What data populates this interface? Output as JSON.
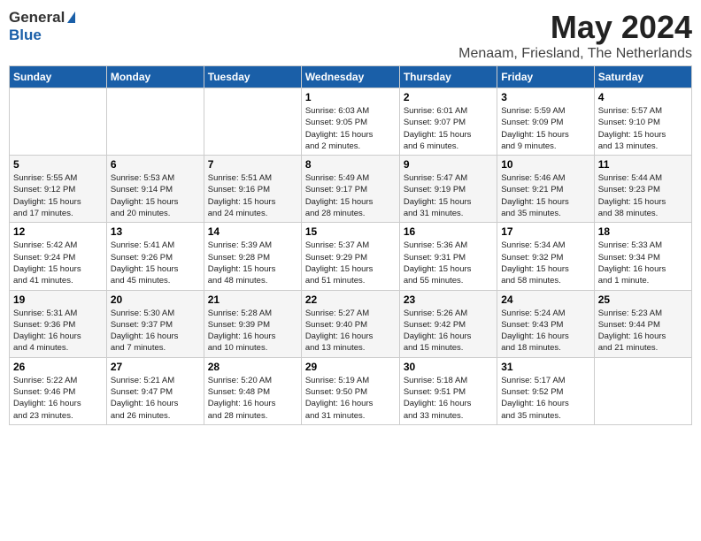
{
  "logo": {
    "general": "General",
    "blue": "Blue"
  },
  "title": "May 2024",
  "location": "Menaam, Friesland, The Netherlands",
  "days_of_week": [
    "Sunday",
    "Monday",
    "Tuesday",
    "Wednesday",
    "Thursday",
    "Friday",
    "Saturday"
  ],
  "weeks": [
    [
      {
        "day": "",
        "info": ""
      },
      {
        "day": "",
        "info": ""
      },
      {
        "day": "",
        "info": ""
      },
      {
        "day": "1",
        "info": "Sunrise: 6:03 AM\nSunset: 9:05 PM\nDaylight: 15 hours\nand 2 minutes."
      },
      {
        "day": "2",
        "info": "Sunrise: 6:01 AM\nSunset: 9:07 PM\nDaylight: 15 hours\nand 6 minutes."
      },
      {
        "day": "3",
        "info": "Sunrise: 5:59 AM\nSunset: 9:09 PM\nDaylight: 15 hours\nand 9 minutes."
      },
      {
        "day": "4",
        "info": "Sunrise: 5:57 AM\nSunset: 9:10 PM\nDaylight: 15 hours\nand 13 minutes."
      }
    ],
    [
      {
        "day": "5",
        "info": "Sunrise: 5:55 AM\nSunset: 9:12 PM\nDaylight: 15 hours\nand 17 minutes."
      },
      {
        "day": "6",
        "info": "Sunrise: 5:53 AM\nSunset: 9:14 PM\nDaylight: 15 hours\nand 20 minutes."
      },
      {
        "day": "7",
        "info": "Sunrise: 5:51 AM\nSunset: 9:16 PM\nDaylight: 15 hours\nand 24 minutes."
      },
      {
        "day": "8",
        "info": "Sunrise: 5:49 AM\nSunset: 9:17 PM\nDaylight: 15 hours\nand 28 minutes."
      },
      {
        "day": "9",
        "info": "Sunrise: 5:47 AM\nSunset: 9:19 PM\nDaylight: 15 hours\nand 31 minutes."
      },
      {
        "day": "10",
        "info": "Sunrise: 5:46 AM\nSunset: 9:21 PM\nDaylight: 15 hours\nand 35 minutes."
      },
      {
        "day": "11",
        "info": "Sunrise: 5:44 AM\nSunset: 9:23 PM\nDaylight: 15 hours\nand 38 minutes."
      }
    ],
    [
      {
        "day": "12",
        "info": "Sunrise: 5:42 AM\nSunset: 9:24 PM\nDaylight: 15 hours\nand 41 minutes."
      },
      {
        "day": "13",
        "info": "Sunrise: 5:41 AM\nSunset: 9:26 PM\nDaylight: 15 hours\nand 45 minutes."
      },
      {
        "day": "14",
        "info": "Sunrise: 5:39 AM\nSunset: 9:28 PM\nDaylight: 15 hours\nand 48 minutes."
      },
      {
        "day": "15",
        "info": "Sunrise: 5:37 AM\nSunset: 9:29 PM\nDaylight: 15 hours\nand 51 minutes."
      },
      {
        "day": "16",
        "info": "Sunrise: 5:36 AM\nSunset: 9:31 PM\nDaylight: 15 hours\nand 55 minutes."
      },
      {
        "day": "17",
        "info": "Sunrise: 5:34 AM\nSunset: 9:32 PM\nDaylight: 15 hours\nand 58 minutes."
      },
      {
        "day": "18",
        "info": "Sunrise: 5:33 AM\nSunset: 9:34 PM\nDaylight: 16 hours\nand 1 minute."
      }
    ],
    [
      {
        "day": "19",
        "info": "Sunrise: 5:31 AM\nSunset: 9:36 PM\nDaylight: 16 hours\nand 4 minutes."
      },
      {
        "day": "20",
        "info": "Sunrise: 5:30 AM\nSunset: 9:37 PM\nDaylight: 16 hours\nand 7 minutes."
      },
      {
        "day": "21",
        "info": "Sunrise: 5:28 AM\nSunset: 9:39 PM\nDaylight: 16 hours\nand 10 minutes."
      },
      {
        "day": "22",
        "info": "Sunrise: 5:27 AM\nSunset: 9:40 PM\nDaylight: 16 hours\nand 13 minutes."
      },
      {
        "day": "23",
        "info": "Sunrise: 5:26 AM\nSunset: 9:42 PM\nDaylight: 16 hours\nand 15 minutes."
      },
      {
        "day": "24",
        "info": "Sunrise: 5:24 AM\nSunset: 9:43 PM\nDaylight: 16 hours\nand 18 minutes."
      },
      {
        "day": "25",
        "info": "Sunrise: 5:23 AM\nSunset: 9:44 PM\nDaylight: 16 hours\nand 21 minutes."
      }
    ],
    [
      {
        "day": "26",
        "info": "Sunrise: 5:22 AM\nSunset: 9:46 PM\nDaylight: 16 hours\nand 23 minutes."
      },
      {
        "day": "27",
        "info": "Sunrise: 5:21 AM\nSunset: 9:47 PM\nDaylight: 16 hours\nand 26 minutes."
      },
      {
        "day": "28",
        "info": "Sunrise: 5:20 AM\nSunset: 9:48 PM\nDaylight: 16 hours\nand 28 minutes."
      },
      {
        "day": "29",
        "info": "Sunrise: 5:19 AM\nSunset: 9:50 PM\nDaylight: 16 hours\nand 31 minutes."
      },
      {
        "day": "30",
        "info": "Sunrise: 5:18 AM\nSunset: 9:51 PM\nDaylight: 16 hours\nand 33 minutes."
      },
      {
        "day": "31",
        "info": "Sunrise: 5:17 AM\nSunset: 9:52 PM\nDaylight: 16 hours\nand 35 minutes."
      },
      {
        "day": "",
        "info": ""
      }
    ]
  ]
}
